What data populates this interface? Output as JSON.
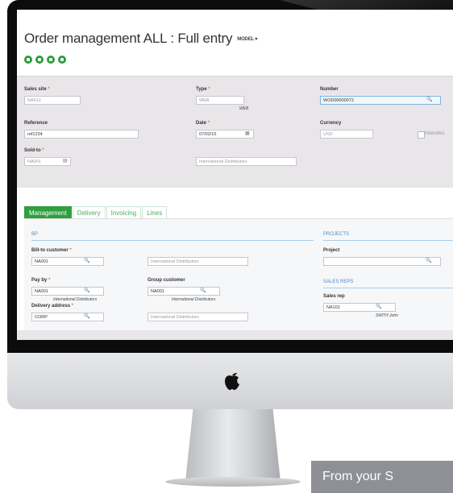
{
  "page": {
    "title": "Order management ALL : Full entry",
    "model_label": "MODEL",
    "banner_text": "From your S"
  },
  "header": {
    "sales_site": {
      "label": "Sales site",
      "value": "NA012"
    },
    "type": {
      "label": "Type",
      "value": "WEB",
      "note": "WEB"
    },
    "number": {
      "label": "Number",
      "value": "WOD00000072"
    },
    "reference": {
      "label": "Reference",
      "value": "ref1234"
    },
    "date": {
      "label": "Date",
      "value": "07/02/15"
    },
    "currency": {
      "label": "Currency",
      "value": "USD",
      "checkbox_label": "Intersites"
    },
    "sold_to": {
      "label": "Sold-to",
      "value": "NA001",
      "desc": "International Distributors"
    }
  },
  "tabs": [
    "Management",
    "Delivery",
    "Invoicing",
    "Lines"
  ],
  "bp": {
    "title": "BP",
    "bill_to": {
      "label": "Bill-to customer",
      "value": "NA001",
      "desc": "International Distributors"
    },
    "pay_by": {
      "label": "Pay by",
      "value": "NA001",
      "note": "International Distributors"
    },
    "group_customer": {
      "label": "Group customer",
      "value": "NA001",
      "note": "International Distributors"
    },
    "delivery_address": {
      "label": "Delivery address",
      "value": "CORP",
      "desc": "International Distributors"
    }
  },
  "projects": {
    "title": "PROJECTS",
    "project_label": "Project",
    "project_value": ""
  },
  "sales_reps": {
    "title": "SALES REPS",
    "rep_label": "Sales rep",
    "rep_value": "NA101",
    "rep_note": "SMITH John"
  },
  "colors": {
    "accent_green": "#2f9e3f",
    "link_blue": "#4b8fc9",
    "required_orange": "#e07b2b"
  },
  "icons": [
    "prev-first-icon",
    "prev-icon",
    "next-icon",
    "next-last-icon",
    "search-icon",
    "document-icon",
    "calendar-icon",
    "apple-logo-icon"
  ]
}
